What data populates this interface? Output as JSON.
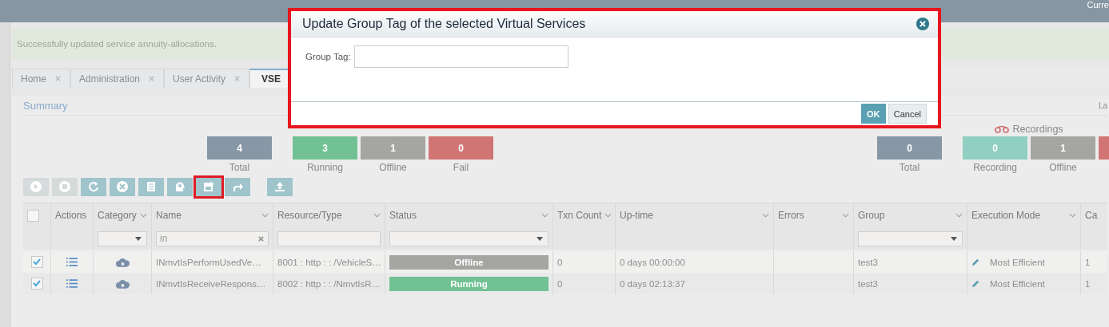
{
  "top_bar": {
    "text": "Curre"
  },
  "message": "Successfully updated service annuity-allocations.",
  "tabs": [
    {
      "label": "Home",
      "selected": false,
      "closable": true
    },
    {
      "label": "Administration",
      "selected": false,
      "closable": true
    },
    {
      "label": "User Activity",
      "selected": false,
      "closable": true
    },
    {
      "label": "VSE",
      "selected": true,
      "closable": false
    }
  ],
  "summary": {
    "title": "Summary",
    "right_text": "La"
  },
  "service_stats": [
    {
      "value": "4",
      "label": "Total",
      "color": "#8797a5"
    },
    {
      "value": "3",
      "label": "Running",
      "color": "#72c194"
    },
    {
      "value": "1",
      "label": "Offline",
      "color": "#a5a5a3"
    },
    {
      "value": "0",
      "label": "Fail",
      "color": "#d17474"
    }
  ],
  "recordings": {
    "title": "Recordings",
    "stats": [
      {
        "value": "0",
        "label": "Total",
        "color": "#8797a5"
      },
      {
        "value": "0",
        "label": "Recording",
        "color": "#90cfc1"
      },
      {
        "value": "1",
        "label": "Offline",
        "color": "#a5a5a3"
      },
      {
        "color": "#d17474"
      }
    ]
  },
  "toolbar": [
    {
      "kind": "play",
      "disabled": true,
      "highlighted": false
    },
    {
      "kind": "stop",
      "disabled": true,
      "highlighted": false
    },
    {
      "kind": "refresh",
      "disabled": false,
      "highlighted": false
    },
    {
      "kind": "delete",
      "disabled": false,
      "highlighted": false
    },
    {
      "kind": "document",
      "disabled": false,
      "highlighted": false
    },
    {
      "kind": "head",
      "disabled": false,
      "highlighted": false
    },
    {
      "kind": "save",
      "disabled": false,
      "highlighted": true
    },
    {
      "kind": "share",
      "disabled": false,
      "highlighted": false
    },
    {
      "kind": "upload",
      "disabled": false,
      "highlighted": false
    }
  ],
  "table": {
    "header_checkbox": {
      "checked": false
    },
    "columns": [
      {
        "label": "Actions",
        "sortable": false,
        "filter": {
          "kind": "none"
        }
      },
      {
        "label": "Category",
        "sortable": true,
        "filter": {
          "kind": "select"
        }
      },
      {
        "label": "Name",
        "sortable": true,
        "filter": {
          "kind": "text",
          "value": "in"
        }
      },
      {
        "label": "Resource/Type",
        "sortable": true,
        "filter": {
          "kind": "text"
        }
      },
      {
        "label": "Status",
        "sortable": true,
        "filter": {
          "kind": "select"
        }
      },
      {
        "label": "Txn Count",
        "sortable": true,
        "filter": {
          "kind": "none"
        }
      },
      {
        "label": "Up-time",
        "sortable": true,
        "filter": {
          "kind": "none"
        }
      },
      {
        "label": "Errors",
        "sortable": true,
        "filter": {
          "kind": "none"
        }
      },
      {
        "label": "Group",
        "sortable": true,
        "filter": {
          "kind": "select"
        }
      },
      {
        "label": "Execution Mode",
        "sortable": true,
        "filter": {
          "kind": "none"
        }
      },
      {
        "label": "Ca",
        "filter": {
          "kind": "none"
        }
      }
    ],
    "rows": [
      {
        "checked": true,
        "name": "INmvtIsPerformUsedVe…",
        "resource": "8001 : http : : /VehicleS…",
        "status": {
          "label": "Offline",
          "color": "#a5a5a3"
        },
        "txn_count": "0",
        "uptime": "0 days 00:00:00",
        "group": "test3",
        "execution_mode": "Most Efficient",
        "column_12": "1"
      },
      {
        "checked": true,
        "name": "INmvtIsReceiveRespons…",
        "resource": "8002 : http : : /NmvtIsR…",
        "status": {
          "label": "Running",
          "color": "#72c194"
        },
        "txn_count": "0",
        "uptime": "0 days 02:13:37",
        "group": "test3",
        "execution_mode": "Most Efficient",
        "column_12": "1"
      }
    ]
  },
  "modal": {
    "title": "Update Group Tag of the selected Virtual Services",
    "field": {
      "label": "Group Tag:"
    },
    "buttons": [
      {
        "label": "OK",
        "kind": "primary"
      },
      {
        "label": "Cancel",
        "kind": "secondary"
      }
    ]
  }
}
